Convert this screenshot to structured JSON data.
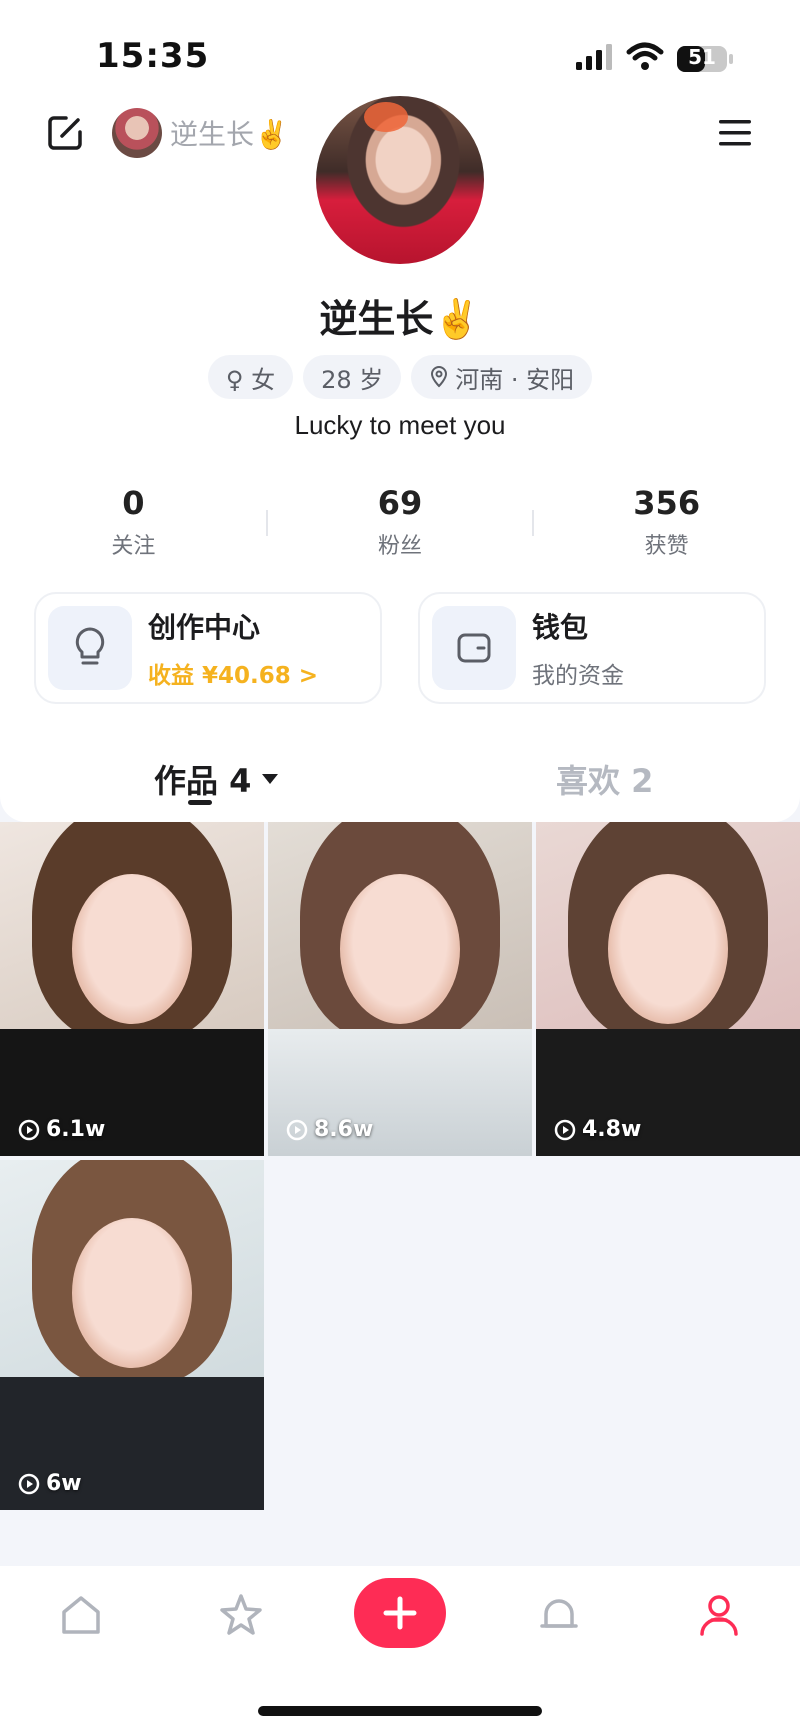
{
  "status_bar": {
    "time": "15:35",
    "battery": "51"
  },
  "header": {
    "mini_name": "逆生长✌️"
  },
  "profile": {
    "name": "逆生长✌️",
    "tags": [
      {
        "icon": "female-icon",
        "label": "♀ 女"
      },
      {
        "label": "28 岁"
      },
      {
        "icon": "location-pin-icon",
        "label": "河南 · 安阳"
      }
    ],
    "bio": "Lucky to meet you"
  },
  "stats": [
    {
      "value": "0",
      "label": "关注"
    },
    {
      "value": "69",
      "label": "粉丝"
    },
    {
      "value": "356",
      "label": "获赞"
    }
  ],
  "cards": {
    "creator": {
      "icon": "lightbulb-icon",
      "title": "创作中心",
      "subtitle": "收益 ¥40.68 >"
    },
    "wallet": {
      "icon": "wallet-icon",
      "title": "钱包",
      "subtitle": "我的资金"
    }
  },
  "tabs": {
    "works": "作品 4",
    "likes": "喜欢 2"
  },
  "videos": [
    {
      "views": "6.1w"
    },
    {
      "views": "8.6w"
    },
    {
      "views": "4.8w"
    },
    {
      "views": "6w"
    }
  ],
  "nav": [
    "home-icon",
    "star-icon",
    "plus-icon",
    "bell-icon",
    "profile-icon"
  ],
  "colors": {
    "accent": "#fe2c55",
    "earnings": "#f5b21f",
    "active_nav": "#fe2c55"
  }
}
